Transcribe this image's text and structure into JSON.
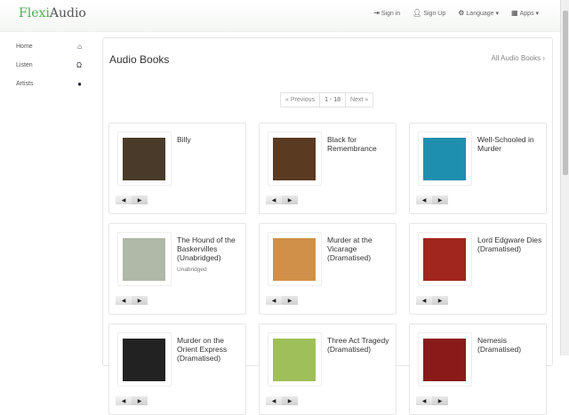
{
  "header": {
    "logo_part1": "Flexi",
    "logo_part2": "Audio",
    "nav": [
      {
        "label": "Sign in",
        "icon": "sign-in-icon"
      },
      {
        "label": "Sign Up",
        "icon": "user-icon"
      },
      {
        "label": "Language ▾",
        "icon": "gear-icon"
      },
      {
        "label": "Apps ▾",
        "icon": "grid-icon"
      }
    ]
  },
  "sidebar": {
    "items": [
      {
        "label": "Home",
        "icon": "home-icon"
      },
      {
        "label": "Listen",
        "icon": "headphones-icon"
      },
      {
        "label": "Artists",
        "icon": "user-icon"
      }
    ]
  },
  "main": {
    "title": "Audio Books",
    "all_link": "All Audio Books",
    "pager": {
      "prev": "« Previous",
      "range": "1 - 18",
      "next": "Next »"
    },
    "books": [
      {
        "title": "Billy",
        "subtitle": "",
        "color": "#4a3a2a"
      },
      {
        "title": "Black for Remembrance",
        "subtitle": "",
        "color": "#5a3a20"
      },
      {
        "title": "Well-Schooled in Murder",
        "subtitle": "",
        "color": "#1f8fb0"
      },
      {
        "title": "The Hound of the Baskervilles (Unabridged)",
        "subtitle": "Unabridged",
        "color": "#b0b8a8"
      },
      {
        "title": "Murder at the Vicarage (Dramatised)",
        "subtitle": "",
        "color": "#d0904a"
      },
      {
        "title": "Lord Edgware Dies (Dramatised)",
        "subtitle": "",
        "color": "#a0261e"
      },
      {
        "title": "Murder on the Orient Express (Dramatised)",
        "subtitle": "",
        "color": "#222"
      },
      {
        "title": "Three Act Tragedy (Dramatised)",
        "subtitle": "",
        "color": "#9fbf5a"
      },
      {
        "title": "Nemesis (Dramatised)",
        "subtitle": "",
        "color": "#8a1a1a"
      }
    ]
  }
}
